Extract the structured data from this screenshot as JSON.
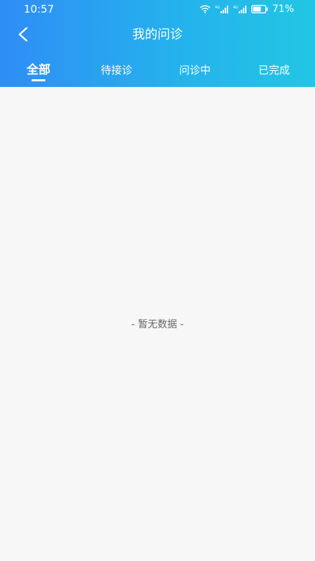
{
  "colors": {
    "header_gradient_start": "#2f8df6",
    "header_gradient_end": "#22c6e3",
    "background": "#f7f7f7",
    "text_on_header": "#ffffff",
    "empty_text": "#666666"
  },
  "status_bar": {
    "time": "10:57",
    "battery": "71%",
    "icons": [
      "wifi-icon",
      "signal-4g-icon",
      "signal-4g-icon",
      "battery-icon"
    ]
  },
  "nav": {
    "back_icon": "chevron-left-icon",
    "title": "我的问诊"
  },
  "tabs": [
    {
      "label": "全部",
      "active": true
    },
    {
      "label": "待接诊",
      "active": false
    },
    {
      "label": "问诊中",
      "active": false
    },
    {
      "label": "已完成",
      "active": false
    }
  ],
  "content": {
    "empty_text": "- 暂无数据 -"
  }
}
